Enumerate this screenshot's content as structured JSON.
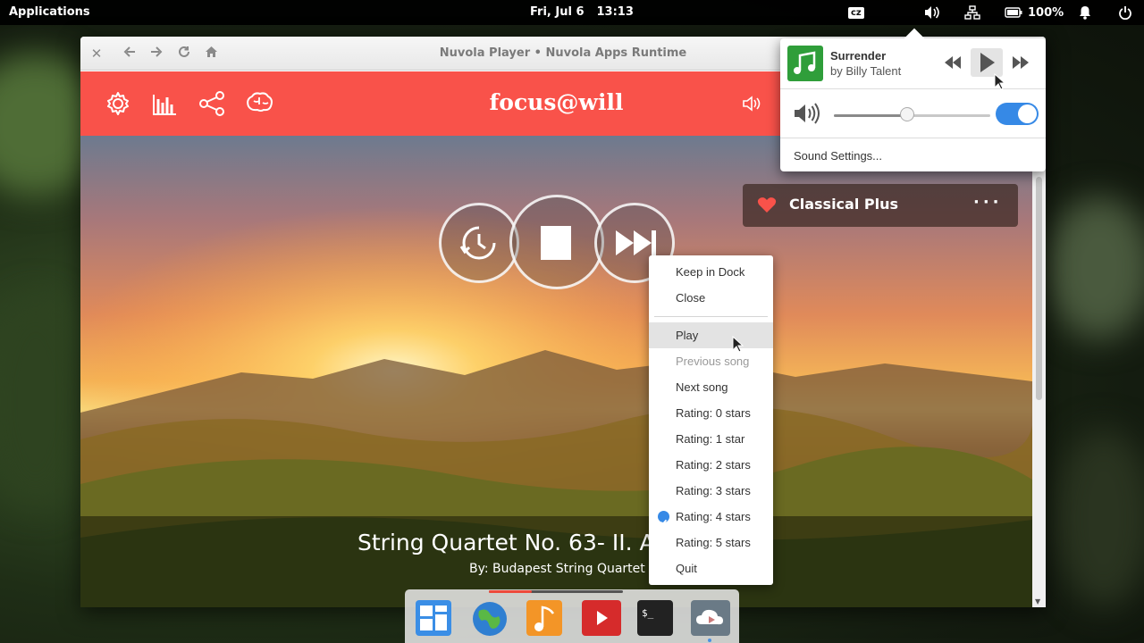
{
  "panel": {
    "applications_label": "Applications",
    "date": "Fri, Jul 6",
    "time": "13:13",
    "keyboard_layout": "cz",
    "battery": "100%"
  },
  "window": {
    "title": "Nuvola Player • Nuvola Apps Runtime"
  },
  "app": {
    "brand": "focus@will",
    "station": {
      "name": "Classical Plus",
      "favorite": true
    },
    "track": {
      "title": "String Quartet No. 63- II. Ac",
      "artist": "By: Budapest String Quartet"
    }
  },
  "context_menu": {
    "items": [
      {
        "label": "Keep in Dock",
        "state": "normal"
      },
      {
        "label": "Close",
        "state": "normal"
      },
      {
        "label": "Play",
        "state": "hover"
      },
      {
        "label": "Previous song",
        "state": "disabled"
      },
      {
        "label": "Next song",
        "state": "normal"
      },
      {
        "label": "Rating: 0 stars",
        "state": "normal"
      },
      {
        "label": "Rating: 1 star",
        "state": "normal"
      },
      {
        "label": "Rating: 2 stars",
        "state": "normal"
      },
      {
        "label": "Rating: 3 stars",
        "state": "normal"
      },
      {
        "label": "Rating: 4 stars",
        "state": "checked"
      },
      {
        "label": "Rating: 5 stars",
        "state": "normal"
      },
      {
        "label": "Quit",
        "state": "normal"
      }
    ]
  },
  "sound_menu": {
    "song": "Surrender",
    "artist": "by Billy Talent",
    "volume_fraction": 0.47,
    "output_enabled": true,
    "settings_label": "Sound Settings..."
  },
  "dock": {
    "progress_fraction": 0.32,
    "apps": [
      "multitasking-view",
      "web-browser",
      "music",
      "video",
      "terminal",
      "nuvola-player"
    ]
  },
  "colors": {
    "brand_red": "#f9524a",
    "accent_blue": "#3689e6",
    "panel_black": "#000000"
  }
}
